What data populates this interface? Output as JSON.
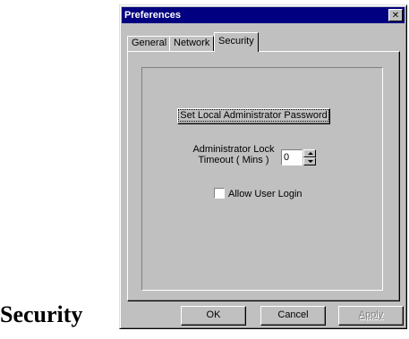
{
  "caption": "Security",
  "window": {
    "title": "Preferences",
    "close_glyph": "✕"
  },
  "tabs": [
    {
      "label": "General",
      "active": false
    },
    {
      "label": "Network",
      "active": false
    },
    {
      "label": "Security",
      "active": true
    }
  ],
  "security": {
    "set_password_label": "Set Local Administrator Password",
    "lock_label_line1": "Administrator Lock",
    "lock_label_line2": "Timeout ( Mins )",
    "lock_timeout_value": "0",
    "allow_login_label": "Allow User Login",
    "allow_login_checked": false
  },
  "buttons": {
    "ok": "OK",
    "cancel": "Cancel",
    "apply": "Apply"
  }
}
